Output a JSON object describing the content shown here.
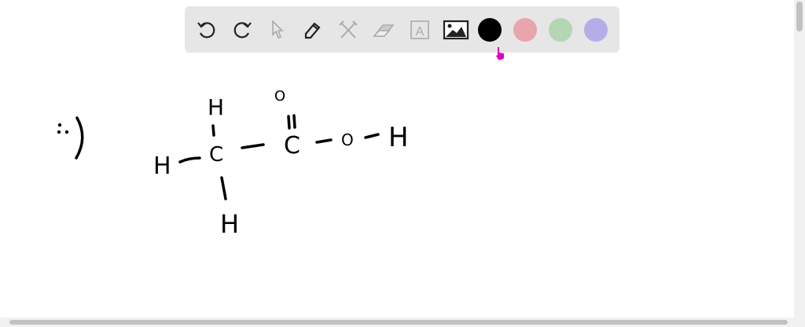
{
  "toolbar": {
    "tools": [
      {
        "name": "undo-icon",
        "enabled": true
      },
      {
        "name": "redo-icon",
        "enabled": true
      },
      {
        "name": "select-pointer-icon",
        "enabled": false
      },
      {
        "name": "pencil-icon",
        "enabled": true
      },
      {
        "name": "tools-icon",
        "enabled": false
      },
      {
        "name": "eraser-icon",
        "enabled": false
      },
      {
        "name": "text-icon",
        "enabled": false,
        "label": "A"
      },
      {
        "name": "image-icon",
        "enabled": true
      }
    ],
    "colors": [
      "#000000",
      "#e8a5ab",
      "#b3d6b3",
      "#b3aee8"
    ],
    "selected_color": "#000000",
    "cursor_color": "#e000c0"
  },
  "drawing": {
    "note": ":)",
    "atoms": {
      "h_top": "H",
      "h_left": "H",
      "c1": "C",
      "h_bottom": "H",
      "o_double": "O",
      "c2": "C",
      "o_single": "O",
      "h_right": "H"
    }
  }
}
